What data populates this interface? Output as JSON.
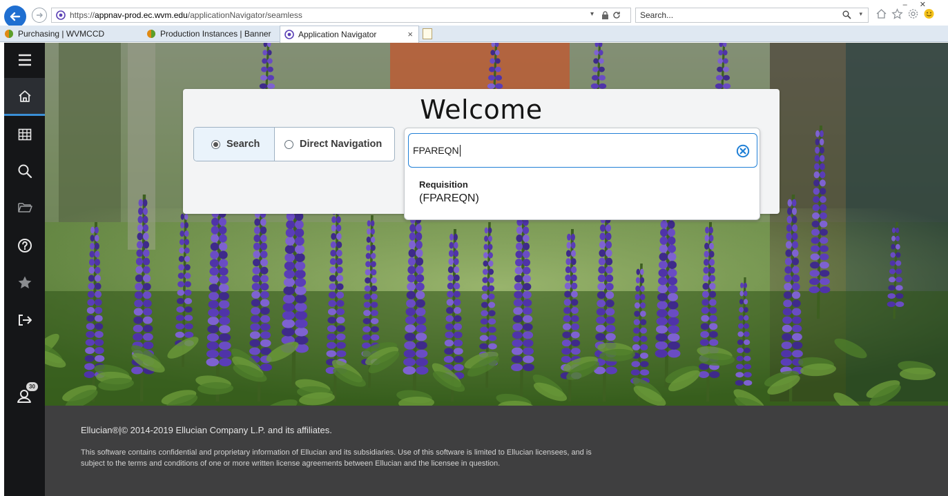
{
  "browser": {
    "url_scheme": "https://",
    "url_host": "appnav-prod.ec.wvm.edu",
    "url_path": "/applicationNavigator/seamless",
    "search_placeholder": "Search...",
    "tabs": [
      {
        "label": "Purchasing | WVMCCD",
        "active": false
      },
      {
        "label": "Production Instances | Banner",
        "active": false
      },
      {
        "label": "Application Navigator",
        "active": true
      }
    ]
  },
  "sidebar": {
    "items": [
      {
        "icon": "menu-icon"
      },
      {
        "icon": "home-icon",
        "active": true
      },
      {
        "icon": "grid-icon"
      },
      {
        "icon": "search-icon"
      },
      {
        "icon": "folder-icon"
      },
      {
        "icon": "help-icon"
      },
      {
        "icon": "star-icon"
      },
      {
        "icon": "sign-out-icon"
      },
      {
        "icon": "user-notification-icon",
        "badge": "30"
      }
    ]
  },
  "welcome": {
    "title": "Welcome",
    "modes": [
      {
        "label": "Search",
        "selected": true
      },
      {
        "label": "Direct Navigation",
        "selected": false
      }
    ],
    "search_value": "FPAREQN",
    "results": [
      {
        "title": "Requisition",
        "code": "(FPAREQN)"
      }
    ]
  },
  "footer": {
    "copyright": "Ellucian®|© 2014-2019 Ellucian Company L.P. and its affiliates.",
    "legal": "This software contains confidential and proprietary information of Ellucian and its subsidiaries. Use of this software is limited to Ellucian licensees, and is subject to the terms and conditions of one or more written license agreements between Ellucian and the licensee in question."
  },
  "colors": {
    "accent": "#1f7fd6",
    "sidebar_bg": "#151618",
    "footer_bg": "#3f3f40",
    "hero_flower": "#5b3fb3"
  }
}
